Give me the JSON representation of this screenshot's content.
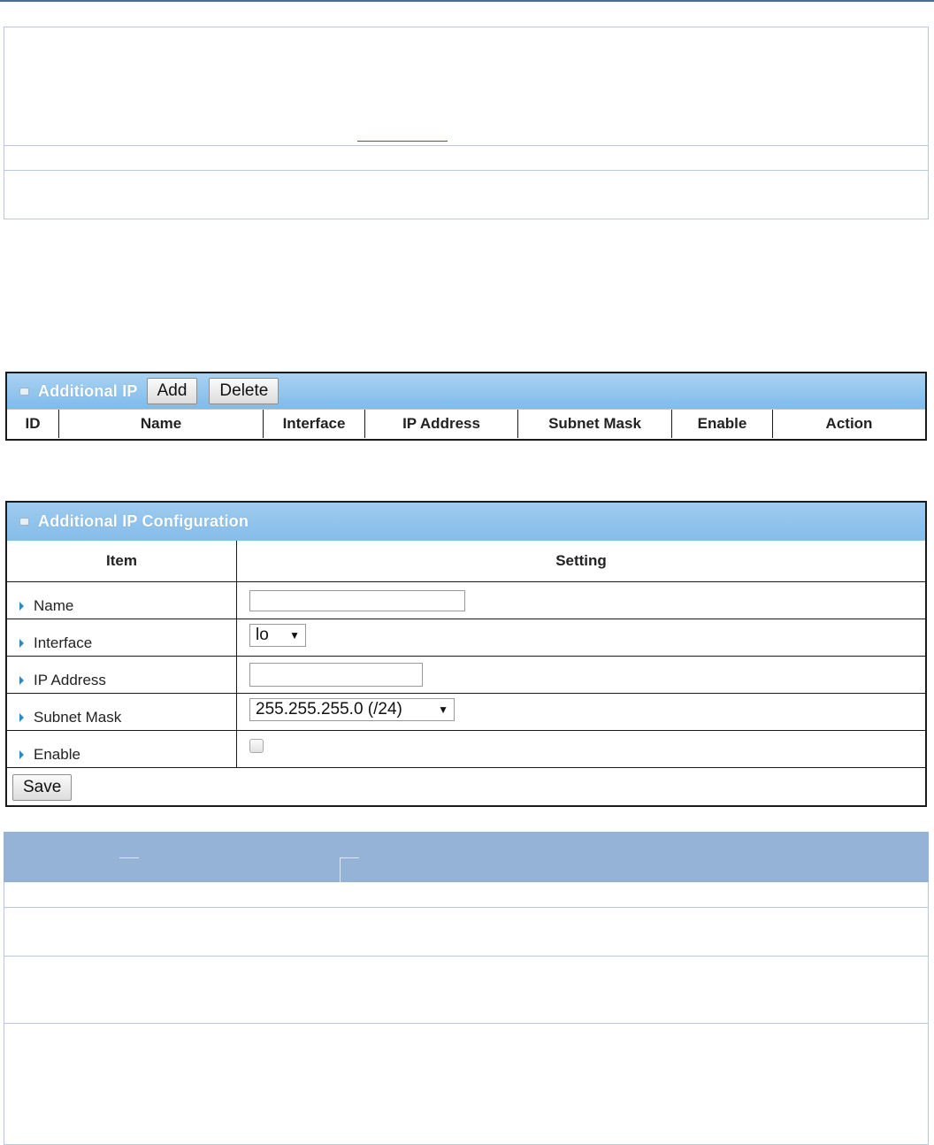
{
  "additional_ip": {
    "title": "Additional IP",
    "add_label": "Add",
    "delete_label": "Delete",
    "columns": [
      "ID",
      "Name",
      "Interface",
      "IP Address",
      "Subnet Mask",
      "Enable",
      "Action"
    ]
  },
  "config": {
    "title": "Additional IP Configuration",
    "col_item": "Item",
    "col_setting": "Setting",
    "rows": {
      "name": {
        "label": "Name",
        "value": ""
      },
      "interface": {
        "label": "Interface",
        "value": "lo"
      },
      "ip_address": {
        "label": "IP Address",
        "value": ""
      },
      "subnet_mask": {
        "label": "Subnet Mask",
        "value": "255.255.255.0 (/24)"
      },
      "enable": {
        "label": "Enable",
        "checked": false
      }
    },
    "save_label": "Save"
  },
  "colors": {
    "panel_header": "#7fbbe8",
    "doc_table_header": "#95b3d7",
    "top_rule": "#4f6e8e"
  }
}
